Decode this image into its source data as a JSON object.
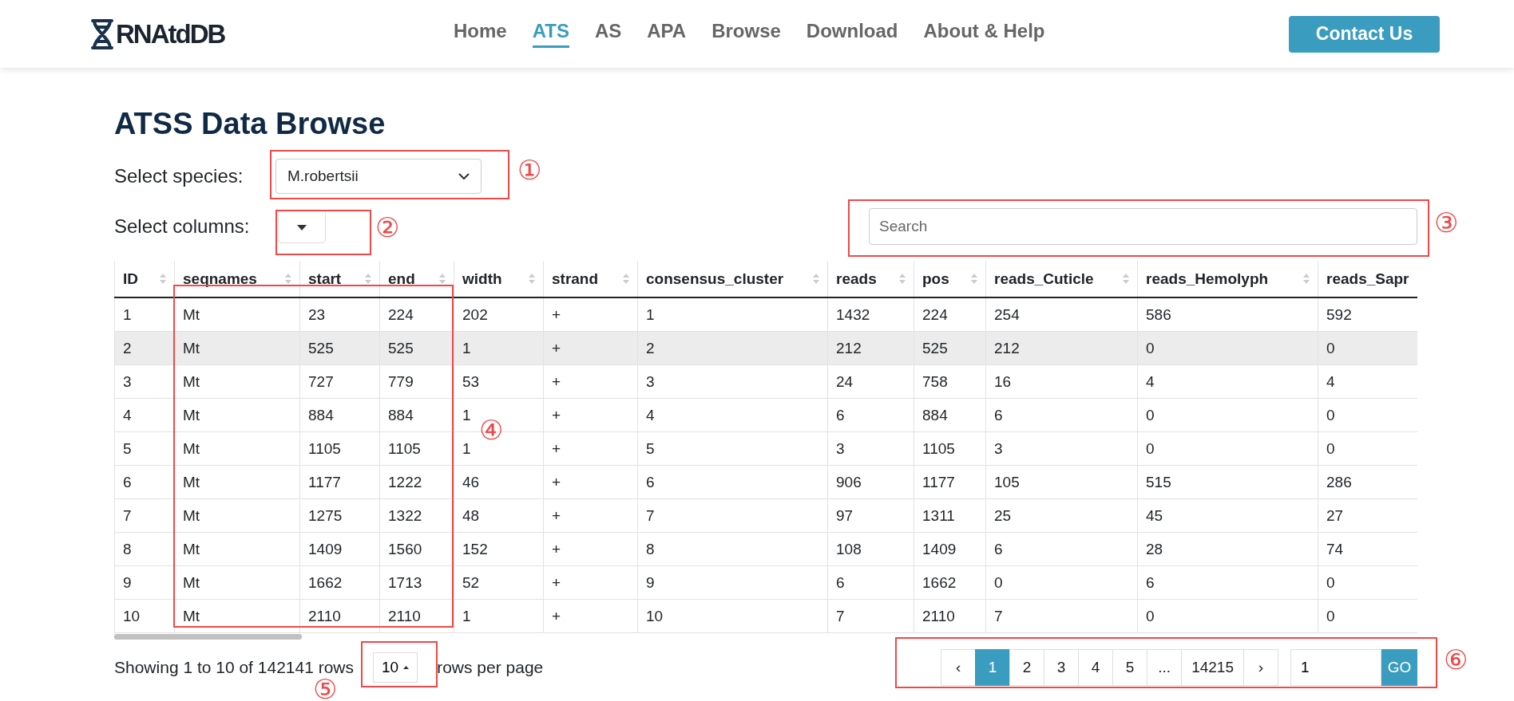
{
  "logo": {
    "text": "RNAtdDB"
  },
  "nav": [
    {
      "label": "Home",
      "selected": false
    },
    {
      "label": "ATS",
      "selected": true
    },
    {
      "label": "AS",
      "selected": false
    },
    {
      "label": "APA",
      "selected": false
    },
    {
      "label": "Browse",
      "selected": false
    },
    {
      "label": "Download",
      "selected": false
    },
    {
      "label": "About & Help",
      "selected": false
    }
  ],
  "contact_button": "Contact Us",
  "title": "ATSS Data Browse",
  "species": {
    "label": "Select species:",
    "value": "M.robertsii"
  },
  "columns_select": {
    "label": "Select columns:"
  },
  "search": {
    "placeholder": "Search"
  },
  "table": {
    "columns": [
      "ID",
      "seqnames",
      "start",
      "end",
      "width",
      "strand",
      "consensus_cluster",
      "reads",
      "pos",
      "reads_Cuticle",
      "reads_Hemolyph",
      "reads_Sapr"
    ],
    "rows": [
      {
        "highlighted": false,
        "cells": [
          "1",
          "Mt",
          "23",
          "224",
          "202",
          "+",
          "1",
          "1432",
          "224",
          "254",
          "586",
          "592"
        ]
      },
      {
        "highlighted": true,
        "cells": [
          "2",
          "Mt",
          "525",
          "525",
          "1",
          "+",
          "2",
          "212",
          "525",
          "212",
          "0",
          "0"
        ]
      },
      {
        "highlighted": false,
        "cells": [
          "3",
          "Mt",
          "727",
          "779",
          "53",
          "+",
          "3",
          "24",
          "758",
          "16",
          "4",
          "4"
        ]
      },
      {
        "highlighted": false,
        "cells": [
          "4",
          "Mt",
          "884",
          "884",
          "1",
          "+",
          "4",
          "6",
          "884",
          "6",
          "0",
          "0"
        ]
      },
      {
        "highlighted": false,
        "cells": [
          "5",
          "Mt",
          "1105",
          "1105",
          "1",
          "+",
          "5",
          "3",
          "1105",
          "3",
          "0",
          "0"
        ]
      },
      {
        "highlighted": false,
        "cells": [
          "6",
          "Mt",
          "1177",
          "1222",
          "46",
          "+",
          "6",
          "906",
          "1177",
          "105",
          "515",
          "286"
        ]
      },
      {
        "highlighted": false,
        "cells": [
          "7",
          "Mt",
          "1275",
          "1322",
          "48",
          "+",
          "7",
          "97",
          "1311",
          "25",
          "45",
          "27"
        ]
      },
      {
        "highlighted": false,
        "cells": [
          "8",
          "Mt",
          "1409",
          "1560",
          "152",
          "+",
          "8",
          "108",
          "1409",
          "6",
          "28",
          "74"
        ]
      },
      {
        "highlighted": false,
        "cells": [
          "9",
          "Mt",
          "1662",
          "1713",
          "52",
          "+",
          "9",
          "6",
          "1662",
          "0",
          "6",
          "0"
        ]
      },
      {
        "highlighted": false,
        "cells": [
          "10",
          "Mt",
          "2110",
          "2110",
          "1",
          "+",
          "10",
          "7",
          "2110",
          "7",
          "0",
          "0"
        ]
      }
    ]
  },
  "footer": {
    "showing": "Showing 1 to 10 of 142141 rows",
    "page_size": "10",
    "per_page": "rows per page"
  },
  "pagination": {
    "prev": "‹",
    "pages": [
      {
        "label": "1",
        "selected": true
      },
      {
        "label": "2",
        "selected": false
      },
      {
        "label": "3",
        "selected": false
      },
      {
        "label": "4",
        "selected": false
      },
      {
        "label": "5",
        "selected": false
      },
      {
        "label": "...",
        "selected": false
      },
      {
        "label": "14215",
        "selected": false
      }
    ],
    "next": "›",
    "go_value": "1",
    "go_button": "GO"
  },
  "annotations": [
    {
      "label": "①"
    },
    {
      "label": "②"
    },
    {
      "label": "③"
    },
    {
      "label": "④"
    },
    {
      "label": "⑤"
    },
    {
      "label": "⑥"
    }
  ]
}
